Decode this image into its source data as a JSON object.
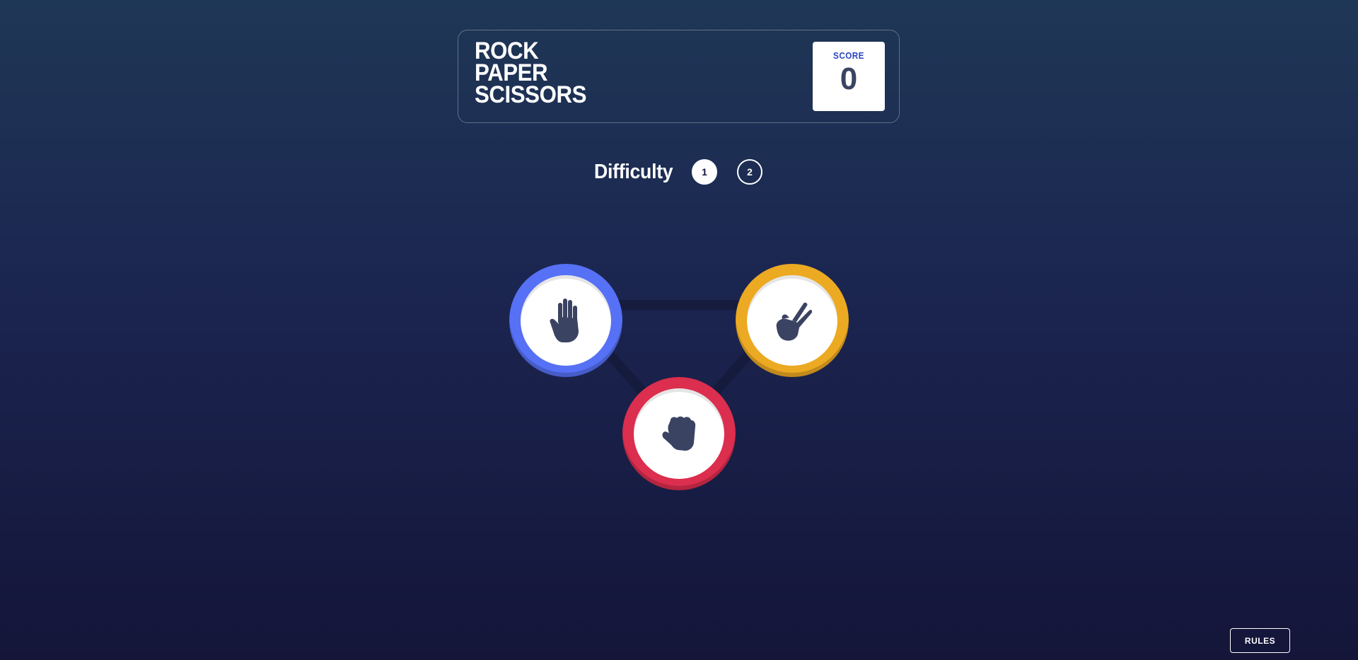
{
  "header": {
    "title_lines": [
      "ROCK",
      "PAPER",
      "SCISSORS"
    ],
    "score_label": "SCORE",
    "score_value": "0"
  },
  "difficulty": {
    "label": "Difficulty",
    "options": [
      {
        "label": "1",
        "selected": true
      },
      {
        "label": "2",
        "selected": false
      }
    ]
  },
  "choices": [
    {
      "name": "paper",
      "icon": "hand-paper-icon",
      "ring_color": "#5671f5"
    },
    {
      "name": "scissors",
      "icon": "hand-scissors-icon",
      "ring_color": "#eca922"
    },
    {
      "name": "rock",
      "icon": "hand-rock-icon",
      "ring_color": "#dc2e4e"
    }
  ],
  "colors": {
    "background_top": "#1f3756",
    "background_bottom": "#141539",
    "icon": "#3b4363",
    "score_label": "#2a46c0"
  },
  "footer": {
    "rules_label": "RULES"
  }
}
